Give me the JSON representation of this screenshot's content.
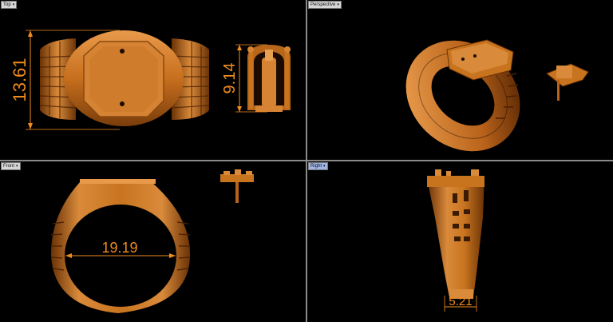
{
  "viewports": {
    "top": {
      "label": "Top",
      "dims": {
        "height": "13.61",
        "figure": "9.14"
      }
    },
    "perspective": {
      "label": "Perspective"
    },
    "front": {
      "label": "Front",
      "dims": {
        "diameter": "19.19"
      }
    },
    "right": {
      "label": "Right",
      "dims": {
        "width": "5.21"
      }
    }
  },
  "colors": {
    "gold": "#c8741f",
    "dimension": "#f08c1e",
    "active_tab": "#9fb6e6"
  }
}
